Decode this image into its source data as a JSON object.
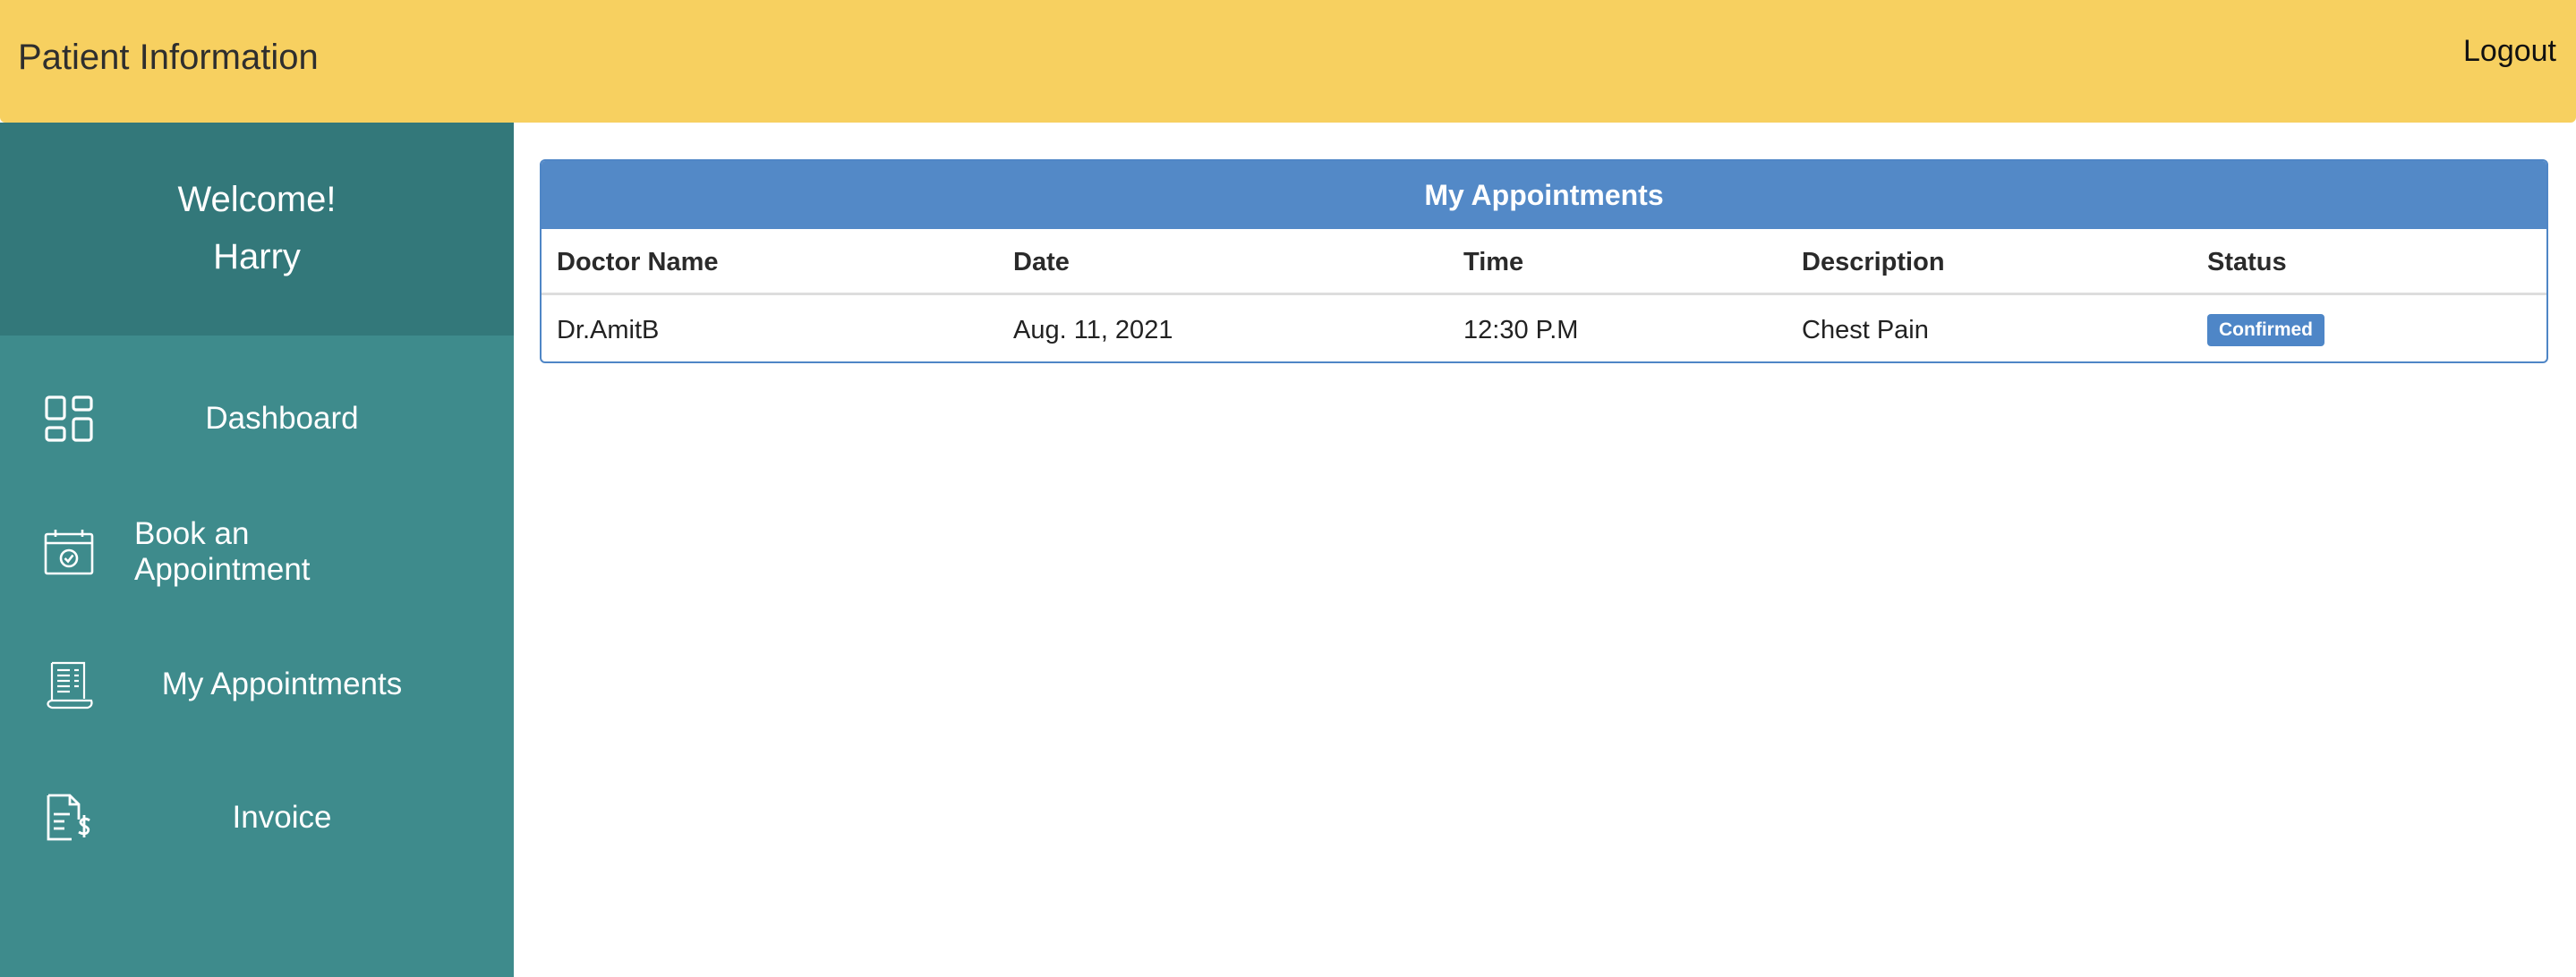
{
  "header": {
    "title": "Patient Information",
    "logout_label": "Logout"
  },
  "sidebar": {
    "welcome_line": "Welcome!",
    "user_name": "Harry",
    "items": [
      {
        "label": "Dashboard",
        "icon": "dashboard-grid-icon"
      },
      {
        "label": "Book an Appointment",
        "icon": "calendar-check-icon"
      },
      {
        "label": "My Appointments",
        "icon": "receipt-scroll-icon"
      },
      {
        "label": "Invoice",
        "icon": "invoice-dollar-icon"
      }
    ]
  },
  "appointments": {
    "title": "My Appointments",
    "columns": [
      "Doctor Name",
      "Date",
      "Time",
      "Description",
      "Status"
    ],
    "rows": [
      {
        "doctor": "Dr.AmitB",
        "date": "Aug. 11, 2021",
        "time": "12:30 P.M",
        "description": "Chest Pain",
        "status": "Confirmed"
      }
    ]
  },
  "colors": {
    "topbar": "#f7d060",
    "sidebar": "#3e8b8c",
    "sidebar_header": "#33787a",
    "panel_header": "#5389c7",
    "status_badge": "#4e86c7"
  }
}
